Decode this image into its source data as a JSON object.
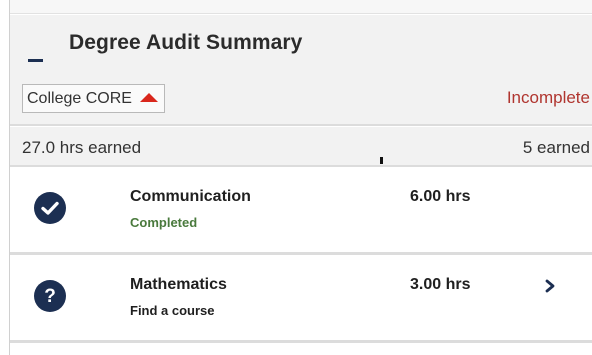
{
  "summary": {
    "title": "Degree Audit Summary",
    "collapse_icon": "minus-icon"
  },
  "core": {
    "label": "College CORE",
    "indicator_icon": "red-triangle-up-icon",
    "status": "Incomplete",
    "hrs_earned": "27.0 hrs earned",
    "earned_count": "5 earned"
  },
  "requirements": [
    {
      "name": "Communication",
      "status": "Completed",
      "hours": "6.00 hrs",
      "icon": "check-circle-icon"
    },
    {
      "name": "Mathematics",
      "status": "Find a course",
      "hours": "3.00 hrs",
      "icon": "question-circle-icon",
      "action_icon": "chevron-right-icon"
    }
  ],
  "colors": {
    "navy": "#1c2f52",
    "incomplete": "#b0352f",
    "completed": "#4a7a3d",
    "triangle": "#d9271c"
  }
}
